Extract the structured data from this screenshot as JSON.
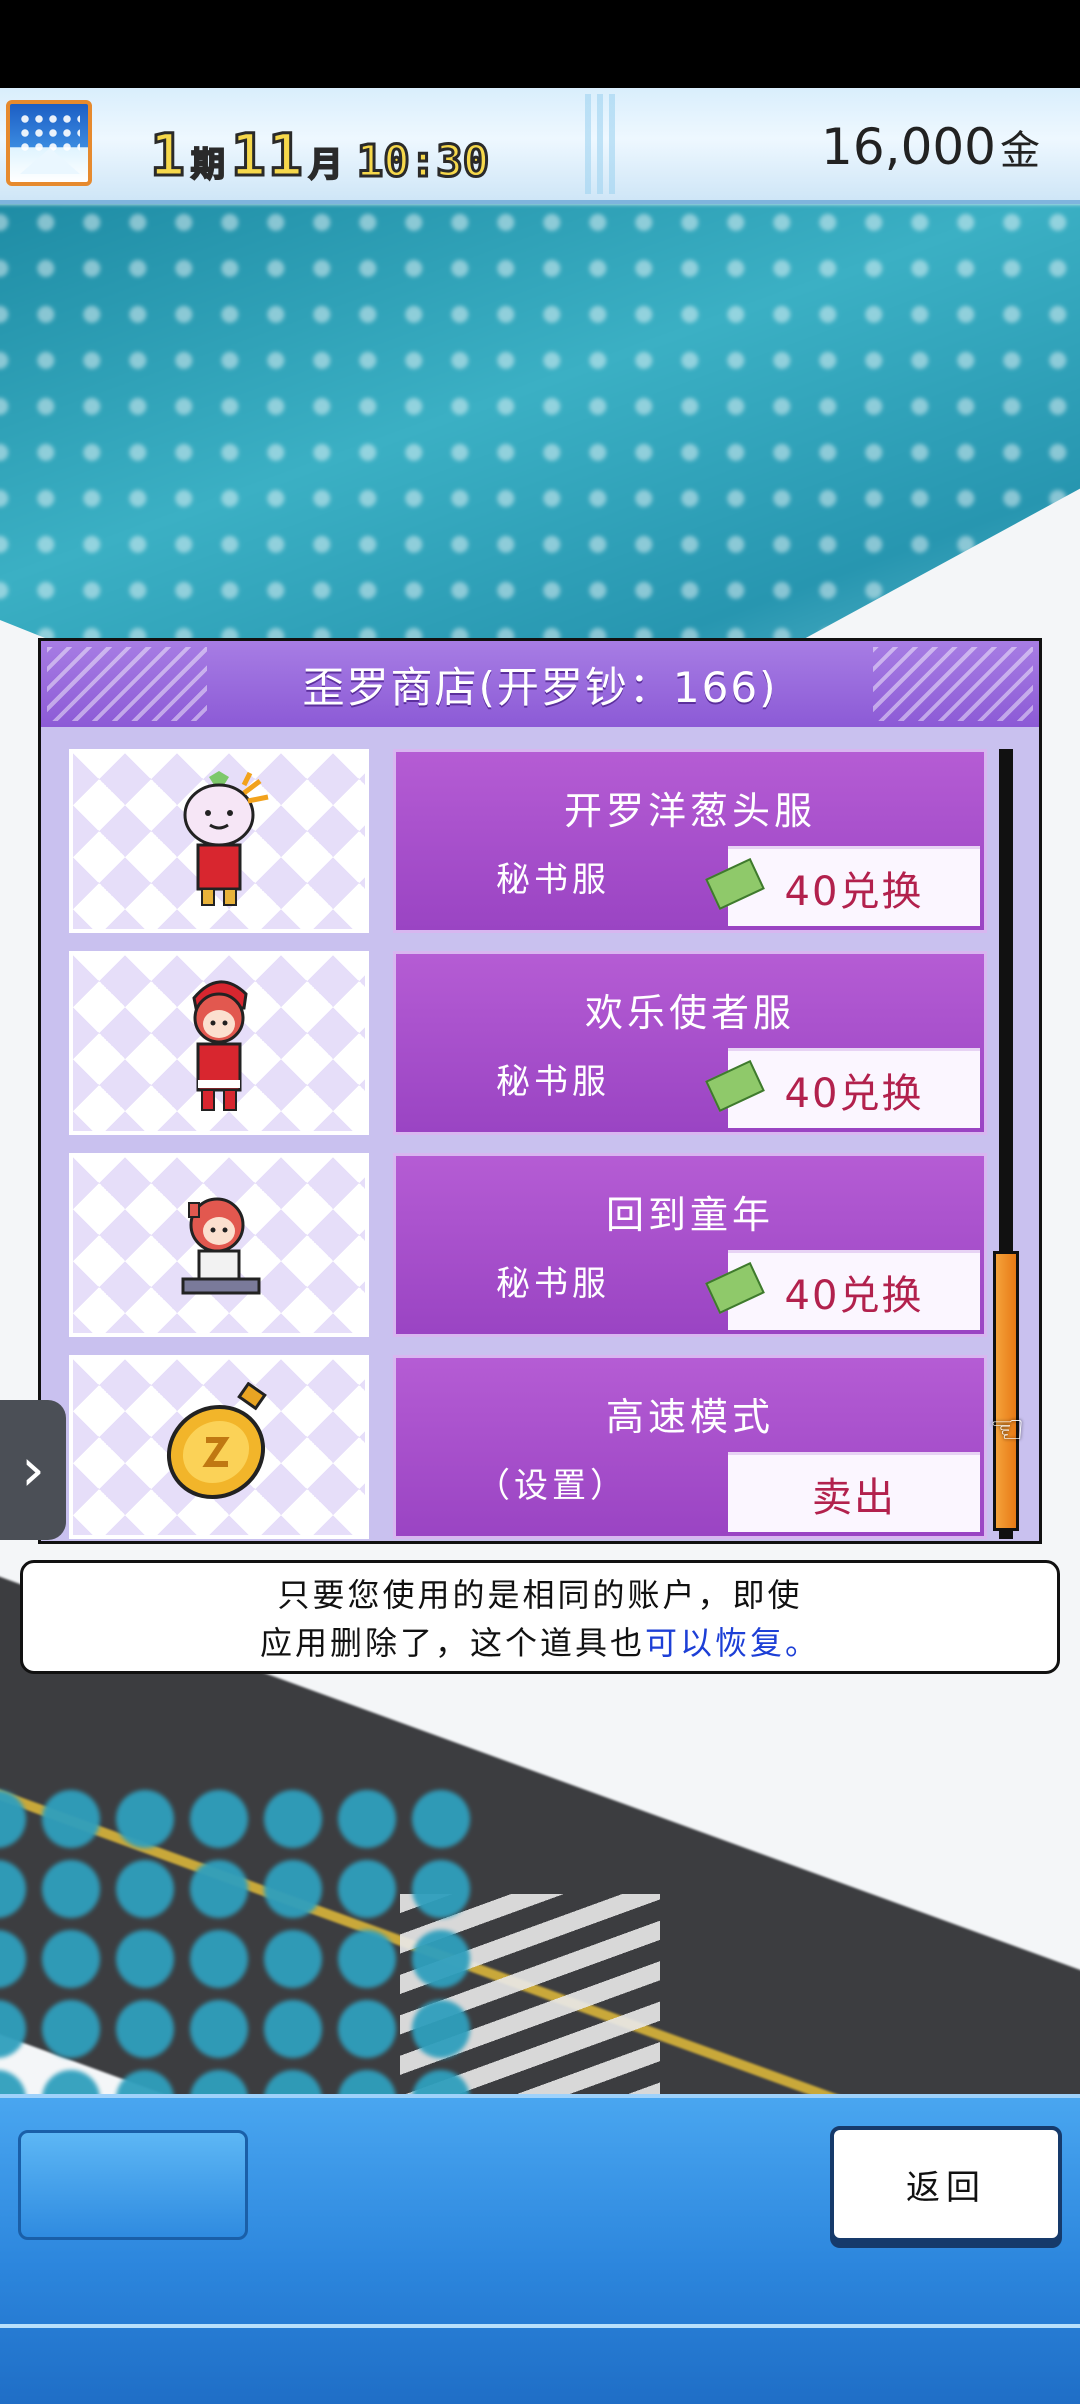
{
  "hud": {
    "year_num": "1",
    "year_unit": "期",
    "month_num": "11",
    "month_unit": "月",
    "time": "10:30",
    "money": "16,000",
    "currency": "金"
  },
  "shop": {
    "title": "歪罗商店(开罗钞：166)",
    "items": [
      {
        "name": "开罗洋葱头服",
        "type": "秘书服",
        "action": "40兑换",
        "icon": "onion-outfit-sprite"
      },
      {
        "name": "欢乐使者服",
        "type": "秘书服",
        "action": "40兑换",
        "icon": "santa-outfit-sprite"
      },
      {
        "name": "回到童年",
        "type": "秘书服",
        "action": "40兑换",
        "icon": "child-outfit-sprite"
      },
      {
        "name": "高速模式",
        "type": "（设置）",
        "action": "卖出",
        "icon": "gold-clock-icon"
      }
    ]
  },
  "message": {
    "line1": "只要您使用的是相同的账户，即使",
    "line2_a": "应用删除了，这个道具也",
    "line2_link": "可以恢复。"
  },
  "nav": {
    "back_label": "返回",
    "side_arrow": "›"
  },
  "colors": {
    "panel_title": "#8c5ad6",
    "item_card": "#a64fcc",
    "price_text": "#b2214d",
    "scroll_thumb": "#f5a23a"
  }
}
